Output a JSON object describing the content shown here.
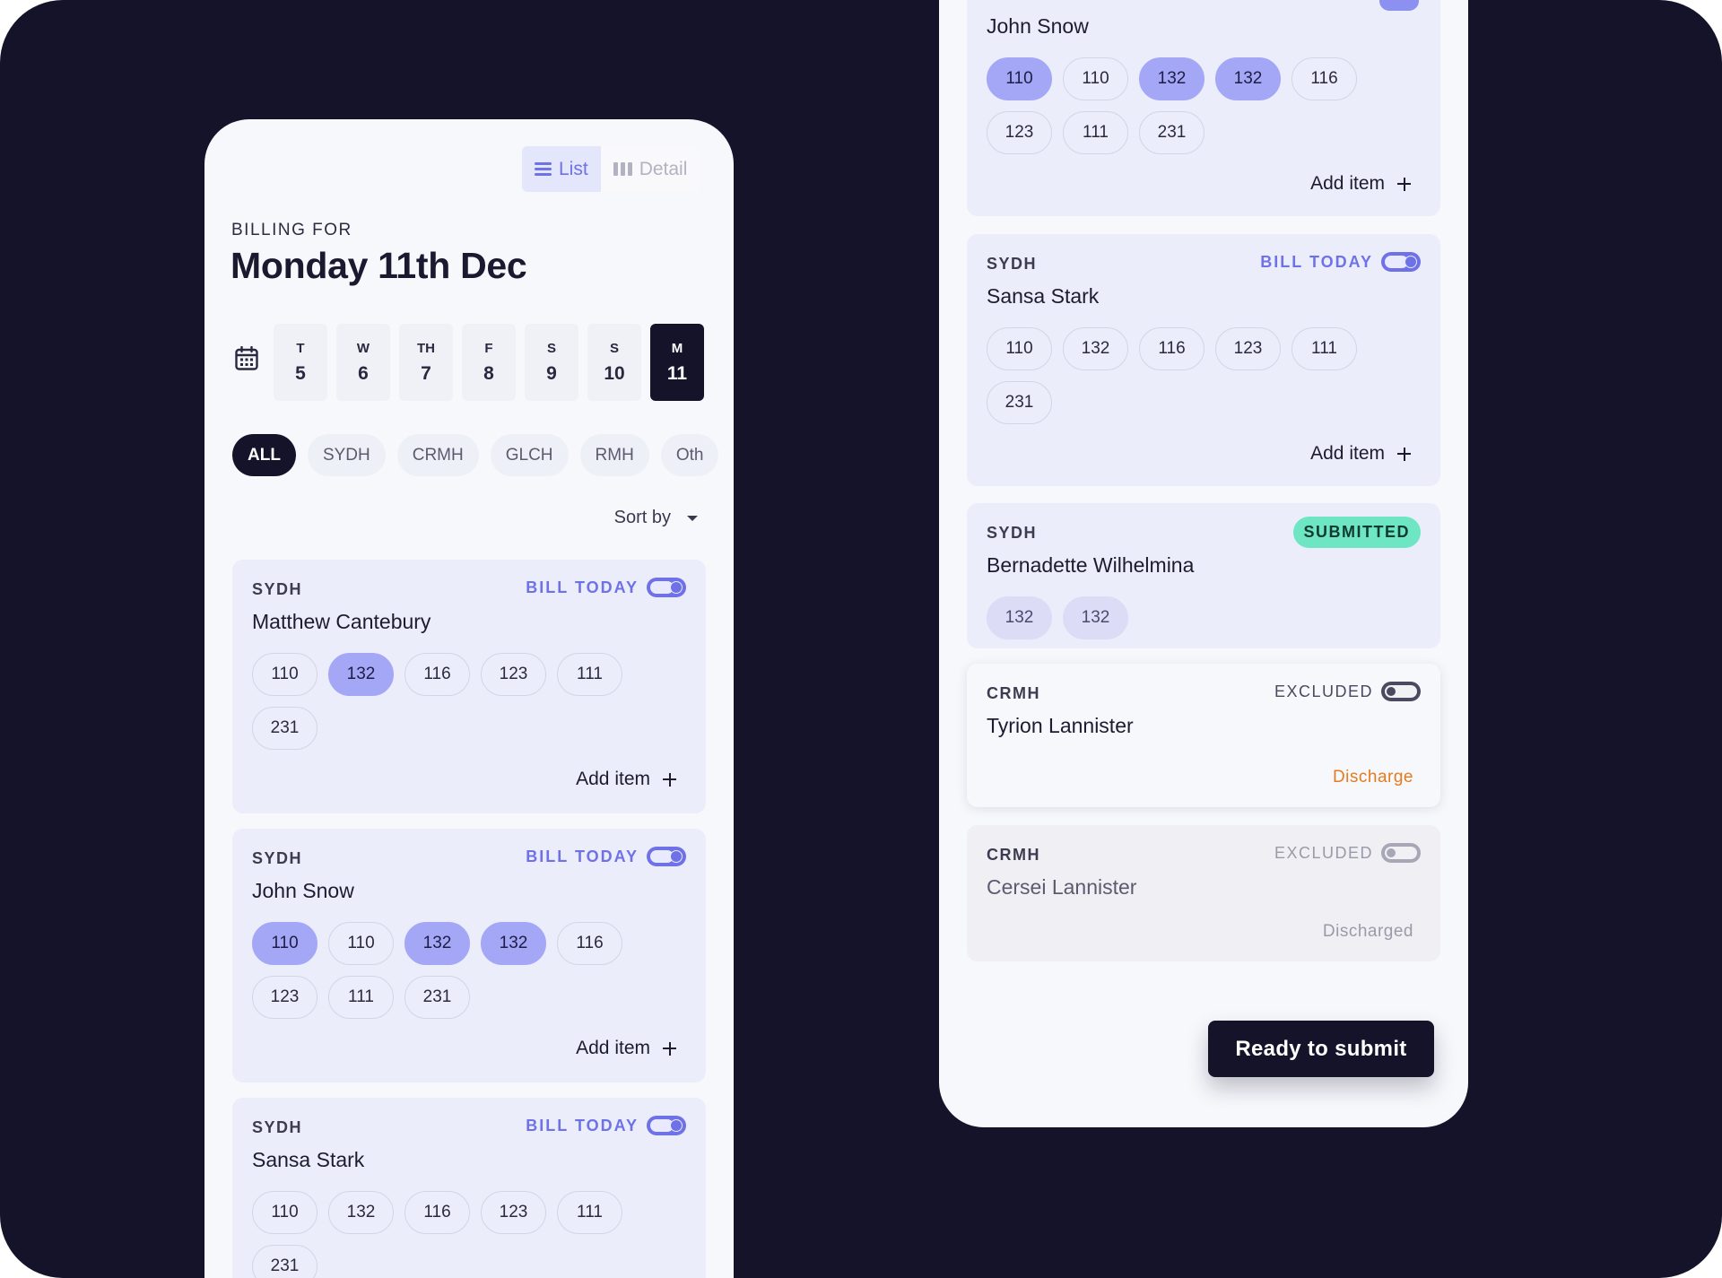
{
  "left_panel": {
    "view_toggle": {
      "list_label": "List",
      "detail_label": "Detail"
    },
    "billing_for_label": "BILLING FOR",
    "title": "Monday 11th Dec",
    "dates": [
      {
        "day": "T",
        "num": "5"
      },
      {
        "day": "W",
        "num": "6"
      },
      {
        "day": "TH",
        "num": "7"
      },
      {
        "day": "F",
        "num": "8"
      },
      {
        "day": "S",
        "num": "9"
      },
      {
        "day": "S",
        "num": "10"
      },
      {
        "day": "M",
        "num": "11",
        "active": true
      }
    ],
    "filters": [
      "ALL",
      "SYDH",
      "CRMH",
      "GLCH",
      "RMH",
      "Oth"
    ],
    "sort_label": "Sort by",
    "cards": [
      {
        "hospital": "SYDH",
        "status": "BILL TODAY",
        "name": "Matthew Cantebury",
        "items": [
          {
            "v": "110"
          },
          {
            "v": "132",
            "sel": true
          },
          {
            "v": "116"
          },
          {
            "v": "123"
          },
          {
            "v": "111"
          },
          {
            "v": "231"
          }
        ],
        "add_label": "Add item"
      },
      {
        "hospital": "SYDH",
        "status": "BILL TODAY",
        "name": "John Snow",
        "items": [
          {
            "v": "110",
            "sel": true
          },
          {
            "v": "110"
          },
          {
            "v": "132",
            "sel": true
          },
          {
            "v": "132",
            "sel": true
          },
          {
            "v": "116"
          },
          {
            "v": "123"
          },
          {
            "v": "111"
          },
          {
            "v": "231"
          }
        ],
        "add_label": "Add item"
      },
      {
        "hospital": "SYDH",
        "status": "BILL TODAY",
        "name": "Sansa Stark",
        "items": [
          {
            "v": "110"
          },
          {
            "v": "132"
          },
          {
            "v": "116"
          },
          {
            "v": "123"
          },
          {
            "v": "111"
          },
          {
            "v": "231"
          }
        ]
      }
    ]
  },
  "right_panel": {
    "cards": [
      {
        "name": "John Snow",
        "items": [
          {
            "v": "110",
            "sel": true
          },
          {
            "v": "110"
          },
          {
            "v": "132",
            "sel": true
          },
          {
            "v": "132",
            "sel": true
          },
          {
            "v": "116"
          },
          {
            "v": "123"
          },
          {
            "v": "111"
          },
          {
            "v": "231"
          }
        ],
        "add_label": "Add item"
      },
      {
        "hospital": "SYDH",
        "status": "BILL TODAY",
        "name": "Sansa Stark",
        "items": [
          {
            "v": "110"
          },
          {
            "v": "132"
          },
          {
            "v": "116"
          },
          {
            "v": "123"
          },
          {
            "v": "111"
          },
          {
            "v": "231"
          }
        ],
        "add_label": "Add item"
      },
      {
        "hospital": "SYDH",
        "badge": "SUBMITTED",
        "name": "Bernadette Wilhelmina",
        "items": [
          {
            "v": "132"
          },
          {
            "v": "132"
          }
        ]
      },
      {
        "hospital": "CRMH",
        "status": "EXCLUDED",
        "name": "Tyrion Lannister",
        "action": "Discharge"
      },
      {
        "hospital": "CRMH",
        "status": "EXCLUDED",
        "name": "Cersei Lannister",
        "action": "Discharged"
      }
    ],
    "submit_label": "Ready to submit"
  },
  "colors": {
    "background": "#15132a",
    "accent": "#6e72e6",
    "selected_item": "#a4a7f5",
    "submitted": "#6fe6c3",
    "discharge": "#e67a1e"
  }
}
